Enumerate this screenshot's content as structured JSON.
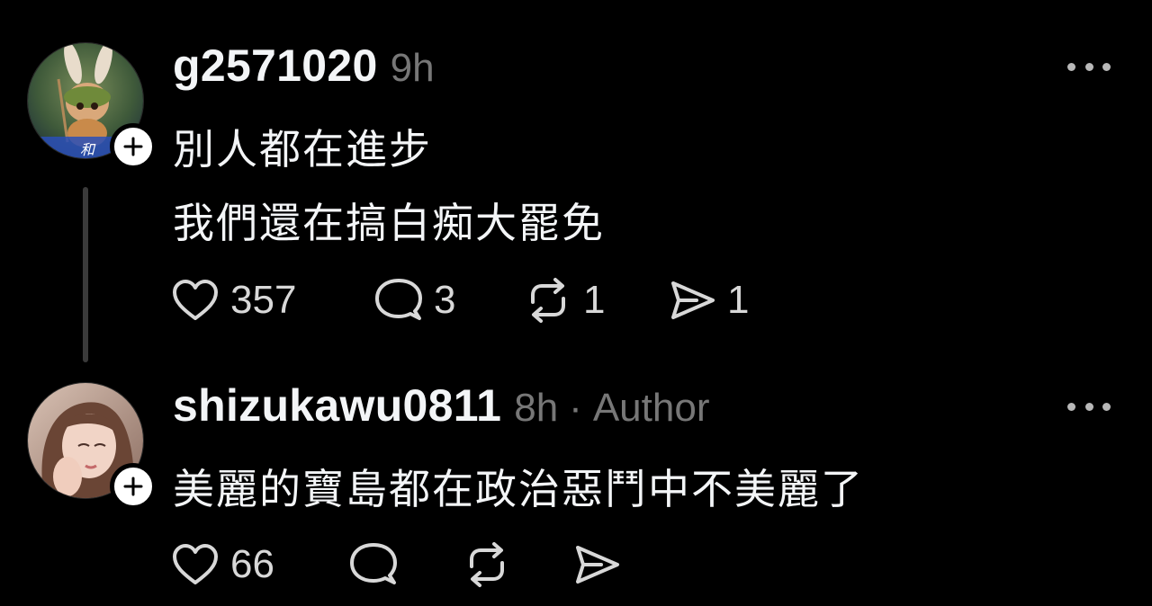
{
  "posts": [
    {
      "username": "g2571020",
      "time": "9h",
      "lines": [
        "別人都在進步",
        "我們還在搞白痴大罷免"
      ],
      "stats": {
        "likes": "357",
        "comments": "3",
        "reposts": "1",
        "shares": "1"
      }
    },
    {
      "username": "shizukawu0811",
      "time": "8h",
      "separator": "·",
      "badge": "Author",
      "lines": [
        "美麗的寶島都在政治惡鬥中不美麗了"
      ],
      "stats": {
        "likes": "66"
      }
    }
  ],
  "icons": {
    "like": "heart-icon",
    "comment": "comment-bubble-icon",
    "repost": "repost-icon",
    "share": "send-icon",
    "more": "more-dots-icon",
    "follow": "plus-icon"
  },
  "colors": {
    "background": "#000000",
    "text": "#f3f5f7",
    "muted": "#777777",
    "thread_line": "#3a3a3a"
  }
}
